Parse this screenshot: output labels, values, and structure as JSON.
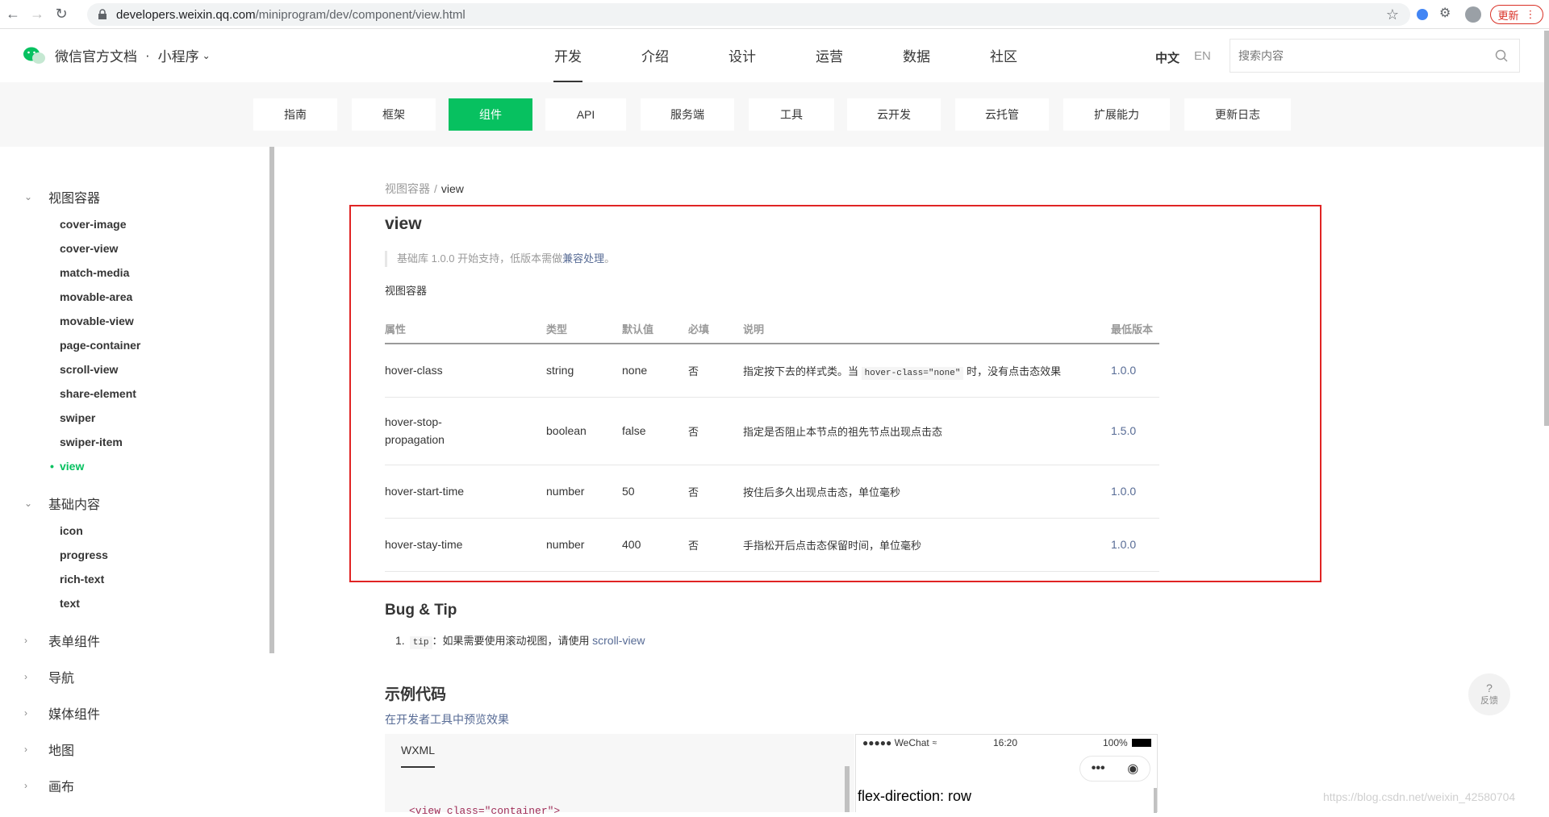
{
  "browser": {
    "url_host": "developers.weixin.qq.com",
    "url_path": "/miniprogram/dev/component/view.html",
    "update_label": "更新"
  },
  "header": {
    "logo_text": "微信官方文档",
    "product": "小程序",
    "nav": [
      {
        "label": "开发",
        "active": true
      },
      {
        "label": "介绍"
      },
      {
        "label": "设计"
      },
      {
        "label": "运营"
      },
      {
        "label": "数据"
      },
      {
        "label": "社区"
      }
    ],
    "lang_zh": "中文",
    "lang_en": "EN",
    "search_placeholder": "搜索内容"
  },
  "subnav": [
    {
      "label": "指南"
    },
    {
      "label": "框架"
    },
    {
      "label": "组件",
      "active": true
    },
    {
      "label": "API"
    },
    {
      "label": "服务端"
    },
    {
      "label": "工具"
    },
    {
      "label": "云开发"
    },
    {
      "label": "云托管"
    },
    {
      "label": "扩展能力"
    },
    {
      "label": "更新日志"
    }
  ],
  "sidebar": {
    "sections": [
      {
        "label": "视图容器",
        "expanded": true,
        "items": [
          "cover-image",
          "cover-view",
          "match-media",
          "movable-area",
          "movable-view",
          "page-container",
          "scroll-view",
          "share-element",
          "swiper",
          "swiper-item",
          "view"
        ]
      },
      {
        "label": "基础内容",
        "expanded": true,
        "items": [
          "icon",
          "progress",
          "rich-text",
          "text"
        ]
      },
      {
        "label": "表单组件",
        "expanded": false
      },
      {
        "label": "导航",
        "expanded": false
      },
      {
        "label": "媒体组件",
        "expanded": false
      },
      {
        "label": "地图",
        "expanded": false
      },
      {
        "label": "画布",
        "expanded": false
      }
    ],
    "active_item": "view"
  },
  "main": {
    "breadcrumb_parent": "视图容器",
    "breadcrumb_current": "view",
    "title": "view",
    "note_prefix": "基础库 1.0.0 开始支持，低版本需做",
    "note_link": "兼容处理",
    "note_suffix": "。",
    "desc": "视图容器",
    "table": {
      "headers": [
        "属性",
        "类型",
        "默认值",
        "必填",
        "说明",
        "最低版本"
      ],
      "rows": [
        {
          "attr": "hover-class",
          "type": "string",
          "default": "none",
          "required": "否",
          "desc_a": "指定按下去的样式类。当 ",
          "desc_code": "hover-class=\"none\"",
          "desc_b": " 时，没有点击态效果",
          "version": "1.0.0"
        },
        {
          "attr": "hover-stop-propagation",
          "type": "boolean",
          "default": "false",
          "required": "否",
          "desc_a": "指定是否阻止本节点的祖先节点出现点击态",
          "desc_code": "",
          "desc_b": "",
          "version": "1.5.0"
        },
        {
          "attr": "hover-start-time",
          "type": "number",
          "default": "50",
          "required": "否",
          "desc_a": "按住后多久出现点击态，单位毫秒",
          "desc_code": "",
          "desc_b": "",
          "version": "1.0.0"
        },
        {
          "attr": "hover-stay-time",
          "type": "number",
          "default": "400",
          "required": "否",
          "desc_a": "手指松开后点击态保留时间，单位毫秒",
          "desc_code": "",
          "desc_b": "",
          "version": "1.0.0"
        }
      ]
    },
    "bug_title": "Bug & Tip",
    "bug_num": "1.",
    "bug_code": "tip",
    "bug_text": "：如果需要使用滚动视图，请使用 ",
    "bug_link": "scroll-view",
    "example_title": "示例代码",
    "preview_link": "在开发者工具中预览效果",
    "code_tab": "WXML",
    "code_line": "<view class=\"container\">",
    "phone": {
      "carrier": "●●●●● WeChat",
      "time": "16:20",
      "battery": "100%",
      "heading": "flex-direction: row"
    }
  },
  "feedback": {
    "icon": "?",
    "label": "反馈"
  },
  "watermark": "https://blog.csdn.net/weixin_42580704"
}
